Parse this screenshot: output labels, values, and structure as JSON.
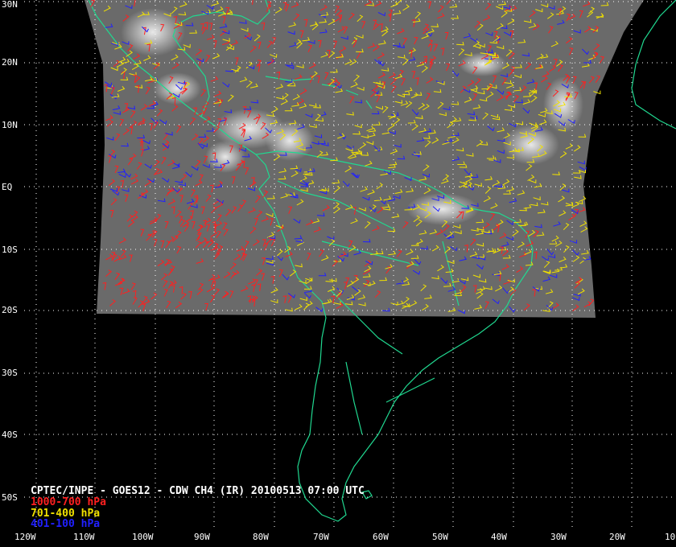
{
  "header": {
    "title": "CPTEC/INPE - GOES12 - CDW CH4 (IR) 20100513 07:00 UTC"
  },
  "legend": [
    {
      "label": "1000-700 hPa",
      "color": "#ff2020"
    },
    {
      "label": "701-400 hPa",
      "color": "#f0e000"
    },
    {
      "label": "401-100 hPa",
      "color": "#2020ff"
    }
  ],
  "axes": {
    "lat_labels": [
      "30N",
      "20N",
      "10N",
      "EQ",
      "10S",
      "20S",
      "30S",
      "40S",
      "50S"
    ],
    "lon_labels": [
      "120W",
      "110W",
      "100W",
      "90W",
      "80W",
      "70W",
      "60W",
      "50W",
      "40W",
      "30W",
      "20W",
      "10"
    ]
  },
  "colors": {
    "background": "#000000",
    "coastline": "#20d890",
    "grid": "#ffffff",
    "satellite_tint": "#6a6a6a"
  }
}
